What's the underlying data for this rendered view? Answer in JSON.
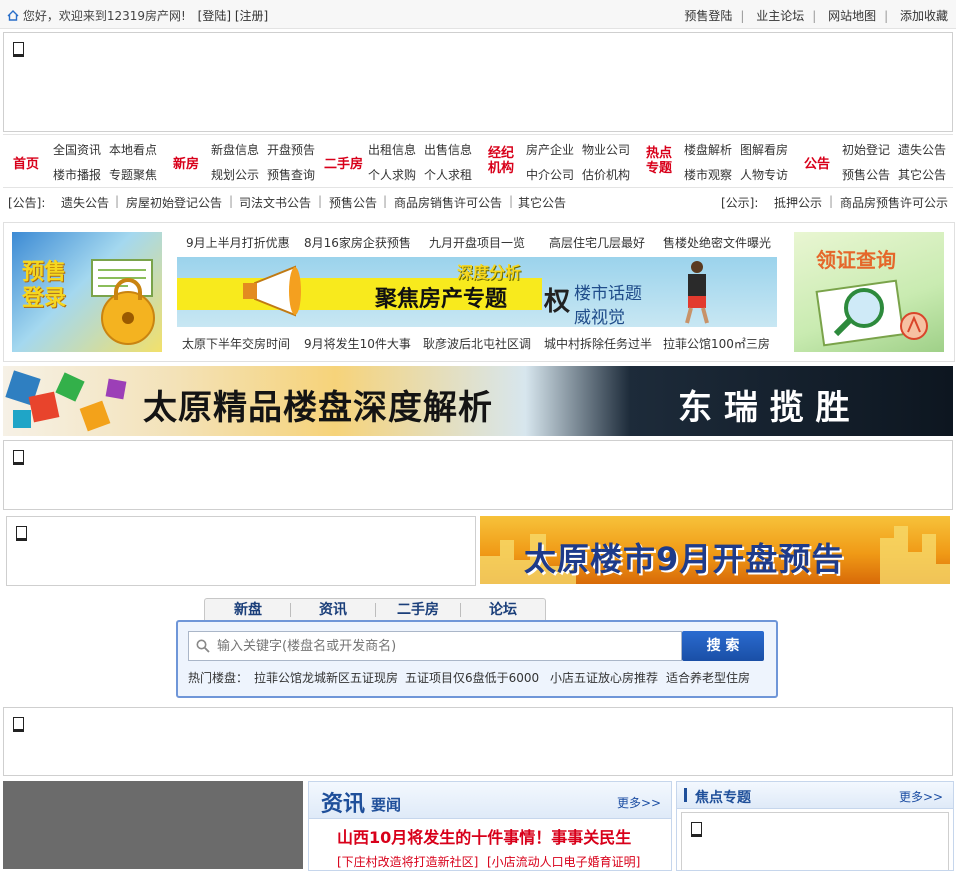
{
  "topbar": {
    "greeting": "您好，欢迎来到12319房产网!",
    "login": "[登陆]",
    "register": "[注册]",
    "links": [
      "预售登陆",
      "业主论坛",
      "网站地图",
      "添加收藏"
    ]
  },
  "nav": {
    "home": "首页",
    "groups": [
      {
        "label": "",
        "items": [
          "全国资讯",
          "本地看点",
          "楼市播报",
          "专题聚焦"
        ]
      },
      {
        "label": "新房",
        "items": [
          "新盘信息",
          "开盘预告",
          "规划公示",
          "预售查询"
        ]
      },
      {
        "label": "二手房",
        "items": [
          "出租信息",
          "出售信息",
          "个人求购",
          "个人求租"
        ]
      },
      {
        "label": "经纪机构",
        "items": [
          "房产企业",
          "物业公司",
          "中介公司",
          "估价机构"
        ]
      },
      {
        "label": "热点专题",
        "items": [
          "楼盘解析",
          "图解看房",
          "楼市观察",
          "人物专访"
        ]
      },
      {
        "label": "公告",
        "items": [
          "初始登记",
          "遗失公告",
          "预售公告",
          "其它公告"
        ]
      }
    ]
  },
  "notice": {
    "left_label": "[公告]:",
    "left_items": [
      "遗失公告",
      "房屋初始登记公告",
      "司法文书公告",
      "预售公告",
      "商品房销售许可公告",
      "其它公告"
    ],
    "right_label": "[公示]:",
    "right_items": [
      "抵押公示",
      "商品房预售许可公示"
    ]
  },
  "promo": {
    "left_banner": "预售登录",
    "right_banner": "领证查询",
    "top_headlines": [
      "9月上半月打折优惠",
      "8月16家房企获预售",
      "九月开盘项目一览",
      "高层住宅几层最好",
      "售楼处绝密文件曝光"
    ],
    "center_banner": {
      "tag": "深度分析",
      "title": "聚焦房产专题",
      "quan": "权",
      "topic": "楼市话题",
      "sub": "威视觉"
    },
    "bottom_headlines": [
      "太原下半年交房时间",
      "9月将发生10件大事",
      "耿彦波后北屯社区调",
      "城中村拆除任务过半",
      "拉菲公馆100㎡三房"
    ]
  },
  "big_banner": {
    "left": "太原精品楼盘深度解析",
    "right": "东 瑞 揽 胜"
  },
  "side_banner": "太原楼市9月开盘预告",
  "search": {
    "tabs": [
      "新盘",
      "资讯",
      "二手房",
      "论坛"
    ],
    "placeholder": "输入关键字(楼盘名或开发商名)",
    "button": "搜 索",
    "hot_label": "热门楼盘：",
    "hot_items": [
      "拉菲公馆龙城新区五证现房",
      "五证项目仅6盘低于6000",
      "小店五证放心房推荐",
      "适合养老型住房"
    ]
  },
  "news": {
    "title_big": "资讯",
    "title_small": "要闻",
    "more": "更多>>",
    "headline": "山西10月将发生的十件事情！事事关民生",
    "sub_links": [
      "[下庄村改造将打造新社区]",
      "[小店流动人口电子婚育证明]"
    ]
  },
  "focus": {
    "title": "焦点专题",
    "more": "更多>>"
  },
  "colors": {
    "accent": "#d8001a",
    "navy": "#1b3f7a",
    "link_blue": "#1d4ea3"
  }
}
